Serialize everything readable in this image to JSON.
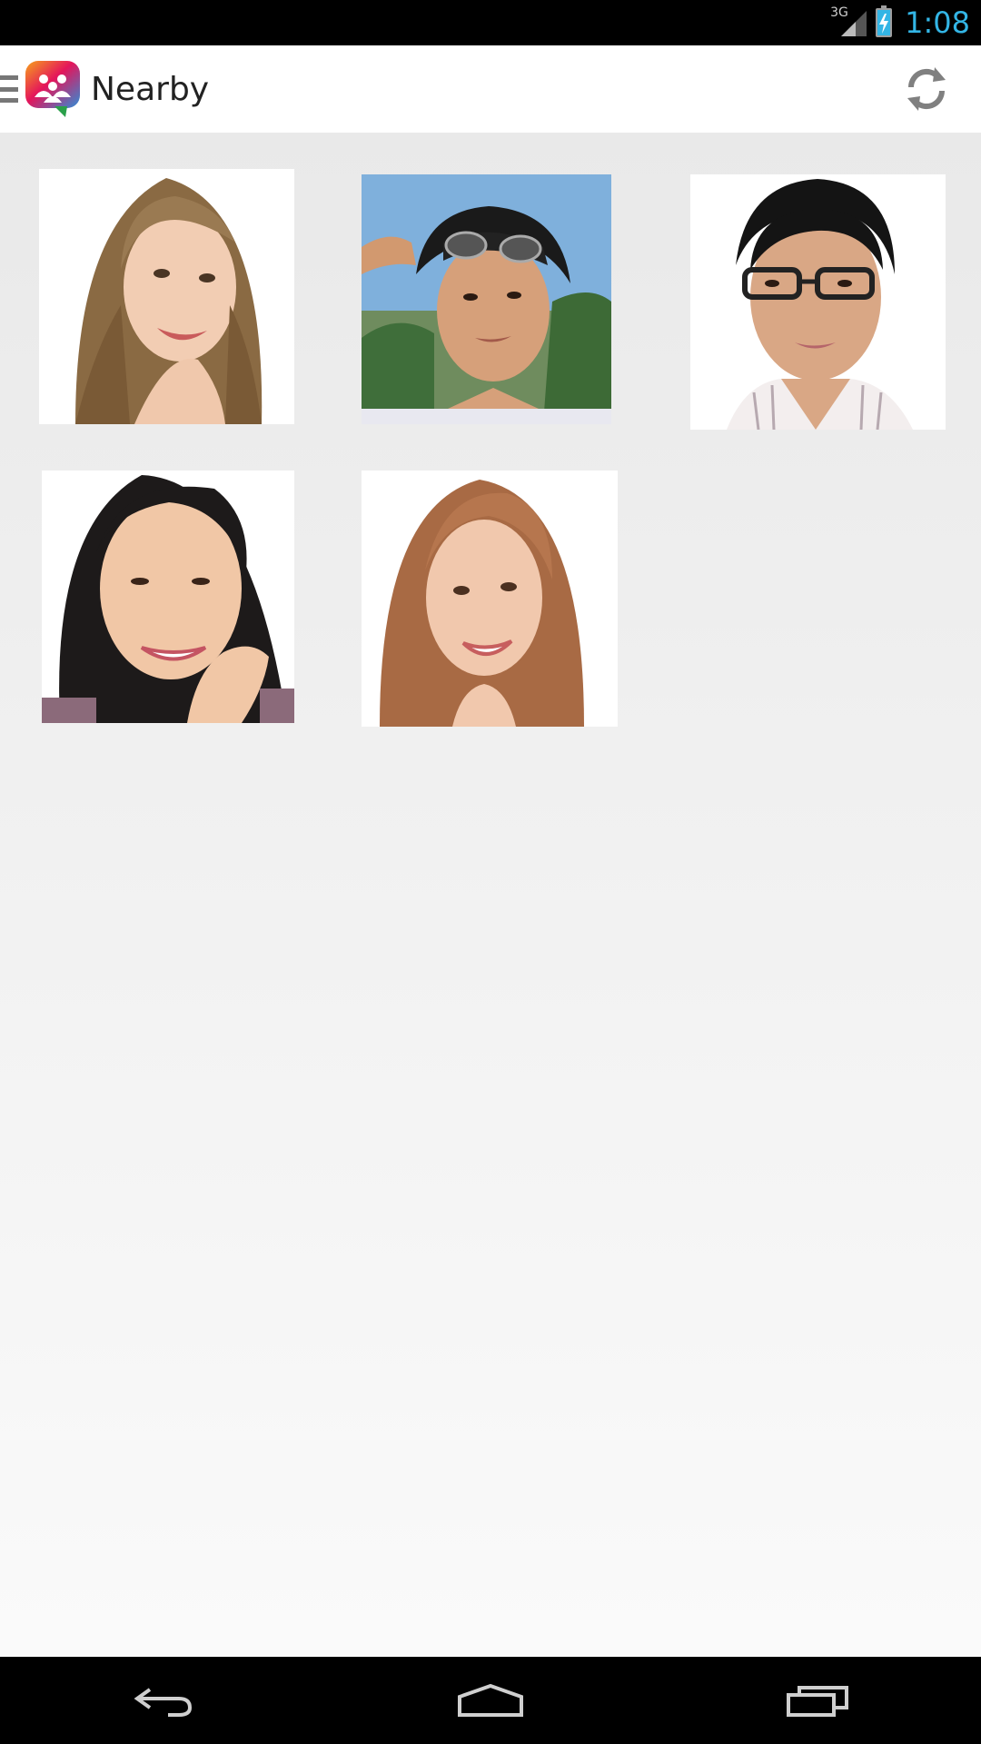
{
  "status_bar": {
    "network": "3G",
    "clock": "1:08",
    "icons": [
      "signal-icon",
      "battery-charging-icon"
    ]
  },
  "action_bar": {
    "title": "Nearby",
    "logo": "app-logo-chat-people-icon",
    "refresh_icon": "refresh-icon"
  },
  "people": [
    {
      "name": "nearby-user-1"
    },
    {
      "name": "nearby-user-2"
    },
    {
      "name": "nearby-user-3"
    },
    {
      "name": "nearby-user-4"
    },
    {
      "name": "nearby-user-5"
    }
  ],
  "nav_bar": {
    "icons": [
      "back-icon",
      "home-icon",
      "recent-apps-icon"
    ]
  },
  "colors": {
    "accent": "#33b5e5",
    "action_bar_bg": "#ffffff",
    "content_bg": "#efefef"
  }
}
